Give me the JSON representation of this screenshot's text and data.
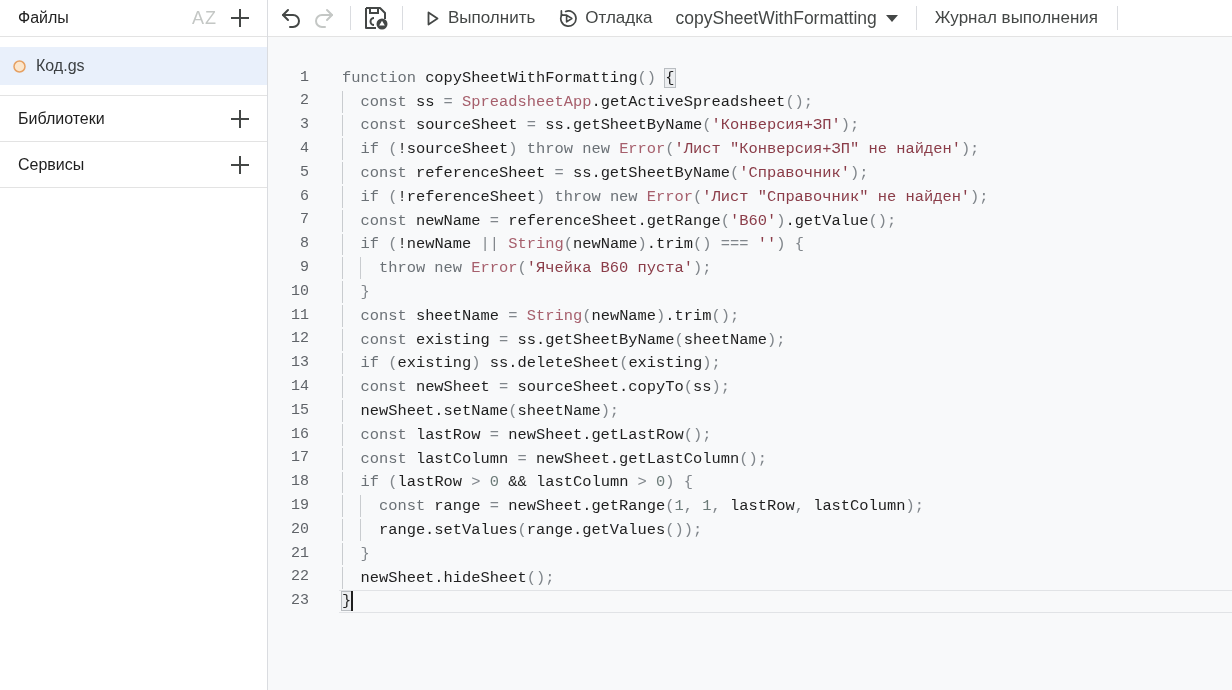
{
  "sidebar": {
    "title": "Файлы",
    "header_buttons": [
      {
        "kind": "sort",
        "label": "AZ",
        "disabled": true
      },
      {
        "kind": "add",
        "disabled": false
      }
    ],
    "files": [
      {
        "name": "Код.gs",
        "selected": true
      }
    ],
    "sections": [
      {
        "label": "Библиотеки"
      },
      {
        "label": "Сервисы"
      }
    ]
  },
  "toolbar": {
    "icon_buttons": [
      {
        "kind": "undo",
        "disabled": false
      },
      {
        "kind": "redo",
        "disabled": true
      },
      {
        "kind": "save",
        "disabled": false
      }
    ],
    "run": {
      "label": "Выполнить"
    },
    "debug": {
      "label": "Отладка"
    },
    "function_select": {
      "value": "copySheetWithFormatting"
    },
    "log": {
      "label": "Журнал выполнения"
    }
  },
  "editor": {
    "lines": [
      {
        "number": "1",
        "active": false,
        "tokens": [
          {
            "kind": "keyword",
            "text": "function"
          },
          {
            "kind": "plain",
            "text": " copySheetWithFormatting"
          },
          {
            "kind": "punct",
            "text": "() "
          },
          {
            "kind": "match",
            "text": "{"
          }
        ]
      },
      {
        "number": "2",
        "active": false,
        "tokens": [
          {
            "kind": "keyword",
            "text": "  const"
          },
          {
            "kind": "plain",
            "text": " ss "
          },
          {
            "kind": "punct",
            "text": "= "
          },
          {
            "kind": "class",
            "text": "SpreadsheetApp"
          },
          {
            "kind": "plain",
            "text": ".getActiveSpreadsheet"
          },
          {
            "kind": "punct",
            "text": "();"
          }
        ]
      },
      {
        "number": "3",
        "active": false,
        "tokens": [
          {
            "kind": "keyword",
            "text": "  const"
          },
          {
            "kind": "plain",
            "text": " sourceSheet "
          },
          {
            "kind": "punct",
            "text": "= "
          },
          {
            "kind": "plain",
            "text": "ss.getSheetByName"
          },
          {
            "kind": "punct",
            "text": "("
          },
          {
            "kind": "string",
            "text": "'Конверсия+ЗП'"
          },
          {
            "kind": "punct",
            "text": ");"
          }
        ]
      },
      {
        "number": "4",
        "active": false,
        "tokens": [
          {
            "kind": "keyword",
            "text": "  if"
          },
          {
            "kind": "punct",
            "text": " ("
          },
          {
            "kind": "plain",
            "text": "!sourceSheet"
          },
          {
            "kind": "punct",
            "text": ") "
          },
          {
            "kind": "keyword",
            "text": "throw new "
          },
          {
            "kind": "class",
            "text": "Error"
          },
          {
            "kind": "punct",
            "text": "("
          },
          {
            "kind": "string",
            "text": "'Лист \"Конверсия+ЗП\" не найден'"
          },
          {
            "kind": "punct",
            "text": ");"
          }
        ]
      },
      {
        "number": "5",
        "active": false,
        "tokens": [
          {
            "kind": "keyword",
            "text": "  const"
          },
          {
            "kind": "plain",
            "text": " referenceSheet "
          },
          {
            "kind": "punct",
            "text": "= "
          },
          {
            "kind": "plain",
            "text": "ss.getSheetByName"
          },
          {
            "kind": "punct",
            "text": "("
          },
          {
            "kind": "string",
            "text": "'Справочник'"
          },
          {
            "kind": "punct",
            "text": ");"
          }
        ]
      },
      {
        "number": "6",
        "active": false,
        "tokens": [
          {
            "kind": "keyword",
            "text": "  if"
          },
          {
            "kind": "punct",
            "text": " ("
          },
          {
            "kind": "plain",
            "text": "!referenceSheet"
          },
          {
            "kind": "punct",
            "text": ") "
          },
          {
            "kind": "keyword",
            "text": "throw new "
          },
          {
            "kind": "class",
            "text": "Error"
          },
          {
            "kind": "punct",
            "text": "("
          },
          {
            "kind": "string",
            "text": "'Лист \"Справочник\" не найден'"
          },
          {
            "kind": "punct",
            "text": ");"
          }
        ]
      },
      {
        "number": "7",
        "active": false,
        "tokens": [
          {
            "kind": "keyword",
            "text": "  const"
          },
          {
            "kind": "plain",
            "text": " newName "
          },
          {
            "kind": "punct",
            "text": "= "
          },
          {
            "kind": "plain",
            "text": "referenceSheet.getRange"
          },
          {
            "kind": "punct",
            "text": "("
          },
          {
            "kind": "string",
            "text": "'B60'"
          },
          {
            "kind": "punct",
            "text": ")"
          },
          {
            "kind": "plain",
            "text": ".getValue"
          },
          {
            "kind": "punct",
            "text": "();"
          }
        ]
      },
      {
        "number": "8",
        "active": false,
        "tokens": [
          {
            "kind": "keyword",
            "text": "  if"
          },
          {
            "kind": "punct",
            "text": " ("
          },
          {
            "kind": "plain",
            "text": "!newName "
          },
          {
            "kind": "punct",
            "text": "|| "
          },
          {
            "kind": "class",
            "text": "String"
          },
          {
            "kind": "punct",
            "text": "("
          },
          {
            "kind": "plain",
            "text": "newName"
          },
          {
            "kind": "punct",
            "text": ")"
          },
          {
            "kind": "plain",
            "text": ".trim"
          },
          {
            "kind": "punct",
            "text": "() === "
          },
          {
            "kind": "string",
            "text": "''"
          },
          {
            "kind": "punct",
            "text": ") {"
          }
        ]
      },
      {
        "number": "9",
        "active": false,
        "tokens": [
          {
            "kind": "keyword",
            "text": "    throw new "
          },
          {
            "kind": "class",
            "text": "Error"
          },
          {
            "kind": "punct",
            "text": "("
          },
          {
            "kind": "string",
            "text": "'Ячейка B60 пуста'"
          },
          {
            "kind": "punct",
            "text": ");"
          }
        ]
      },
      {
        "number": "10",
        "active": false,
        "tokens": [
          {
            "kind": "punct",
            "text": "  }"
          }
        ]
      },
      {
        "number": "11",
        "active": false,
        "tokens": [
          {
            "kind": "keyword",
            "text": "  const"
          },
          {
            "kind": "plain",
            "text": " sheetName "
          },
          {
            "kind": "punct",
            "text": "= "
          },
          {
            "kind": "class",
            "text": "String"
          },
          {
            "kind": "punct",
            "text": "("
          },
          {
            "kind": "plain",
            "text": "newName"
          },
          {
            "kind": "punct",
            "text": ")"
          },
          {
            "kind": "plain",
            "text": ".trim"
          },
          {
            "kind": "punct",
            "text": "();"
          }
        ]
      },
      {
        "number": "12",
        "active": false,
        "tokens": [
          {
            "kind": "keyword",
            "text": "  const"
          },
          {
            "kind": "plain",
            "text": " existing "
          },
          {
            "kind": "punct",
            "text": "= "
          },
          {
            "kind": "plain",
            "text": "ss.getSheetByName"
          },
          {
            "kind": "punct",
            "text": "("
          },
          {
            "kind": "plain",
            "text": "sheetName"
          },
          {
            "kind": "punct",
            "text": ");"
          }
        ]
      },
      {
        "number": "13",
        "active": false,
        "tokens": [
          {
            "kind": "keyword",
            "text": "  if"
          },
          {
            "kind": "punct",
            "text": " ("
          },
          {
            "kind": "plain",
            "text": "existing"
          },
          {
            "kind": "punct",
            "text": ") "
          },
          {
            "kind": "plain",
            "text": "ss.deleteSheet"
          },
          {
            "kind": "punct",
            "text": "("
          },
          {
            "kind": "plain",
            "text": "existing"
          },
          {
            "kind": "punct",
            "text": ");"
          }
        ]
      },
      {
        "number": "14",
        "active": false,
        "tokens": [
          {
            "kind": "keyword",
            "text": "  const"
          },
          {
            "kind": "plain",
            "text": " newSheet "
          },
          {
            "kind": "punct",
            "text": "= "
          },
          {
            "kind": "plain",
            "text": "sourceSheet.copyTo"
          },
          {
            "kind": "punct",
            "text": "("
          },
          {
            "kind": "plain",
            "text": "ss"
          },
          {
            "kind": "punct",
            "text": ");"
          }
        ]
      },
      {
        "number": "15",
        "active": false,
        "tokens": [
          {
            "kind": "plain",
            "text": "  newSheet.setName"
          },
          {
            "kind": "punct",
            "text": "("
          },
          {
            "kind": "plain",
            "text": "sheetName"
          },
          {
            "kind": "punct",
            "text": ");"
          }
        ]
      },
      {
        "number": "16",
        "active": false,
        "tokens": [
          {
            "kind": "keyword",
            "text": "  const"
          },
          {
            "kind": "plain",
            "text": " lastRow "
          },
          {
            "kind": "punct",
            "text": "= "
          },
          {
            "kind": "plain",
            "text": "newSheet.getLastRow"
          },
          {
            "kind": "punct",
            "text": "();"
          }
        ]
      },
      {
        "number": "17",
        "active": false,
        "tokens": [
          {
            "kind": "keyword",
            "text": "  const"
          },
          {
            "kind": "plain",
            "text": " lastColumn "
          },
          {
            "kind": "punct",
            "text": "= "
          },
          {
            "kind": "plain",
            "text": "newSheet.getLastColumn"
          },
          {
            "kind": "punct",
            "text": "();"
          }
        ]
      },
      {
        "number": "18",
        "active": false,
        "tokens": [
          {
            "kind": "keyword",
            "text": "  if"
          },
          {
            "kind": "punct",
            "text": " ("
          },
          {
            "kind": "plain",
            "text": "lastRow "
          },
          {
            "kind": "punct",
            "text": "> "
          },
          {
            "kind": "number",
            "text": "0"
          },
          {
            "kind": "plain",
            "text": " && lastColumn "
          },
          {
            "kind": "punct",
            "text": "> "
          },
          {
            "kind": "number",
            "text": "0"
          },
          {
            "kind": "punct",
            "text": ") {"
          }
        ]
      },
      {
        "number": "19",
        "active": false,
        "tokens": [
          {
            "kind": "keyword",
            "text": "    const"
          },
          {
            "kind": "plain",
            "text": " range "
          },
          {
            "kind": "punct",
            "text": "= "
          },
          {
            "kind": "plain",
            "text": "newSheet.getRange"
          },
          {
            "kind": "punct",
            "text": "("
          },
          {
            "kind": "number",
            "text": "1"
          },
          {
            "kind": "punct",
            "text": ", "
          },
          {
            "kind": "number",
            "text": "1"
          },
          {
            "kind": "punct",
            "text": ", "
          },
          {
            "kind": "plain",
            "text": "lastRow"
          },
          {
            "kind": "punct",
            "text": ", "
          },
          {
            "kind": "plain",
            "text": "lastColumn"
          },
          {
            "kind": "punct",
            "text": ");"
          }
        ]
      },
      {
        "number": "20",
        "active": false,
        "tokens": [
          {
            "kind": "plain",
            "text": "    range.setValues"
          },
          {
            "kind": "punct",
            "text": "("
          },
          {
            "kind": "plain",
            "text": "range.getValues"
          },
          {
            "kind": "punct",
            "text": "());"
          }
        ]
      },
      {
        "number": "21",
        "active": false,
        "tokens": [
          {
            "kind": "punct",
            "text": "  }"
          }
        ]
      },
      {
        "number": "22",
        "active": false,
        "tokens": [
          {
            "kind": "plain",
            "text": "  newSheet.hideSheet"
          },
          {
            "kind": "punct",
            "text": "();"
          }
        ]
      },
      {
        "number": "23",
        "active": true,
        "tokens": [
          {
            "kind": "match",
            "text": "}"
          }
        ]
      }
    ]
  }
}
